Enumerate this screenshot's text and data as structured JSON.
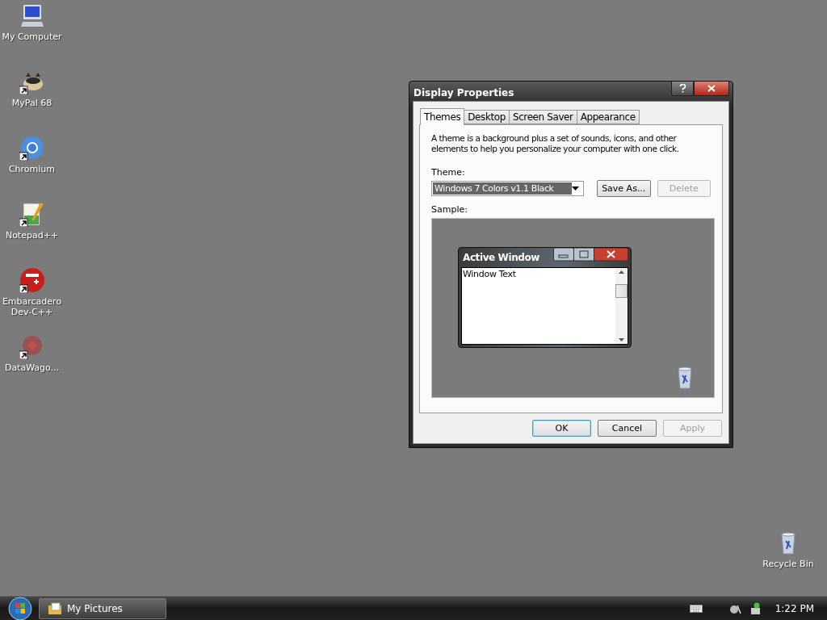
{
  "desktop": {
    "icons": [
      {
        "label": "My Computer",
        "kind": "computer",
        "shortcut": false
      },
      {
        "label": "MyPal 68",
        "kind": "raccoon",
        "shortcut": true
      },
      {
        "label": "Chromium",
        "kind": "chromium",
        "shortcut": true
      },
      {
        "label": "Notepad++",
        "kind": "notepad",
        "shortcut": true
      },
      {
        "label": "Embarcadero Dev-C++",
        "kind": "devcpp",
        "shortcut": true
      },
      {
        "label": "DataWago...",
        "kind": "datawagon",
        "shortcut": true
      }
    ],
    "recycle_bin": {
      "label": "Recycle Bin"
    }
  },
  "dialog": {
    "title": "Display Properties",
    "tabs": [
      {
        "label": "Themes",
        "selected": true
      },
      {
        "label": "Desktop",
        "selected": false
      },
      {
        "label": "Screen Saver",
        "selected": false
      },
      {
        "label": "Appearance",
        "selected": false
      }
    ],
    "description": "A theme is a background plus a set of sounds, icons, and other elements to help you personalize your computer with one click.",
    "theme_label": "Theme:",
    "theme_value": "Windows 7 Colors v1.1 Black",
    "theme_buttons": [
      {
        "label": "Save As...",
        "disabled": false
      },
      {
        "label": "Delete",
        "disabled": true
      }
    ],
    "sample_label": "Sample:",
    "sample": {
      "window_title": "Active Window",
      "window_text": "Window Text"
    },
    "footer_buttons": [
      {
        "label": "OK",
        "disabled": false,
        "default": true
      },
      {
        "label": "Cancel",
        "disabled": false,
        "default": false
      },
      {
        "label": "Apply",
        "disabled": true,
        "default": false
      }
    ]
  },
  "taskbar": {
    "tasks": [
      {
        "label": "My Pictures"
      }
    ],
    "clock": "1:22 PM"
  }
}
